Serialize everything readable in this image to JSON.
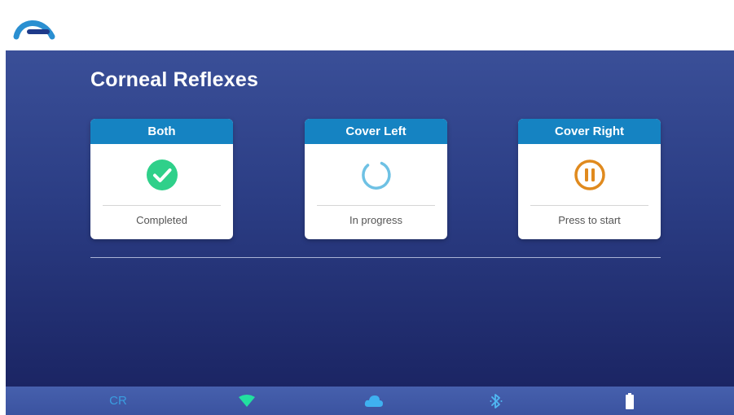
{
  "app": {
    "logo": "app-logo-icon"
  },
  "page": {
    "title": "Corneal Reflexes"
  },
  "cards": [
    {
      "title": "Both",
      "icon": "check-circle-icon",
      "status": "Completed",
      "icon_color": "#2fd08a"
    },
    {
      "title": "Cover Left",
      "icon": "loading-spinner-icon",
      "status": "In progress",
      "icon_color": "#6ec1e4"
    },
    {
      "title": "Cover Right",
      "icon": "pause-circle-icon",
      "status": "Press to start",
      "icon_color": "#e08a1e"
    }
  ],
  "statusbar": {
    "label": "CR",
    "icons": [
      "wifi-icon",
      "cloud-icon",
      "bluetooth-icon",
      "battery-icon"
    ]
  },
  "colors": {
    "header_blue": "#1583c2",
    "background_top": "#3a4f98",
    "background_bottom": "#1b2564",
    "accent_green": "#2fd08a",
    "accent_orange": "#e08a1e"
  }
}
